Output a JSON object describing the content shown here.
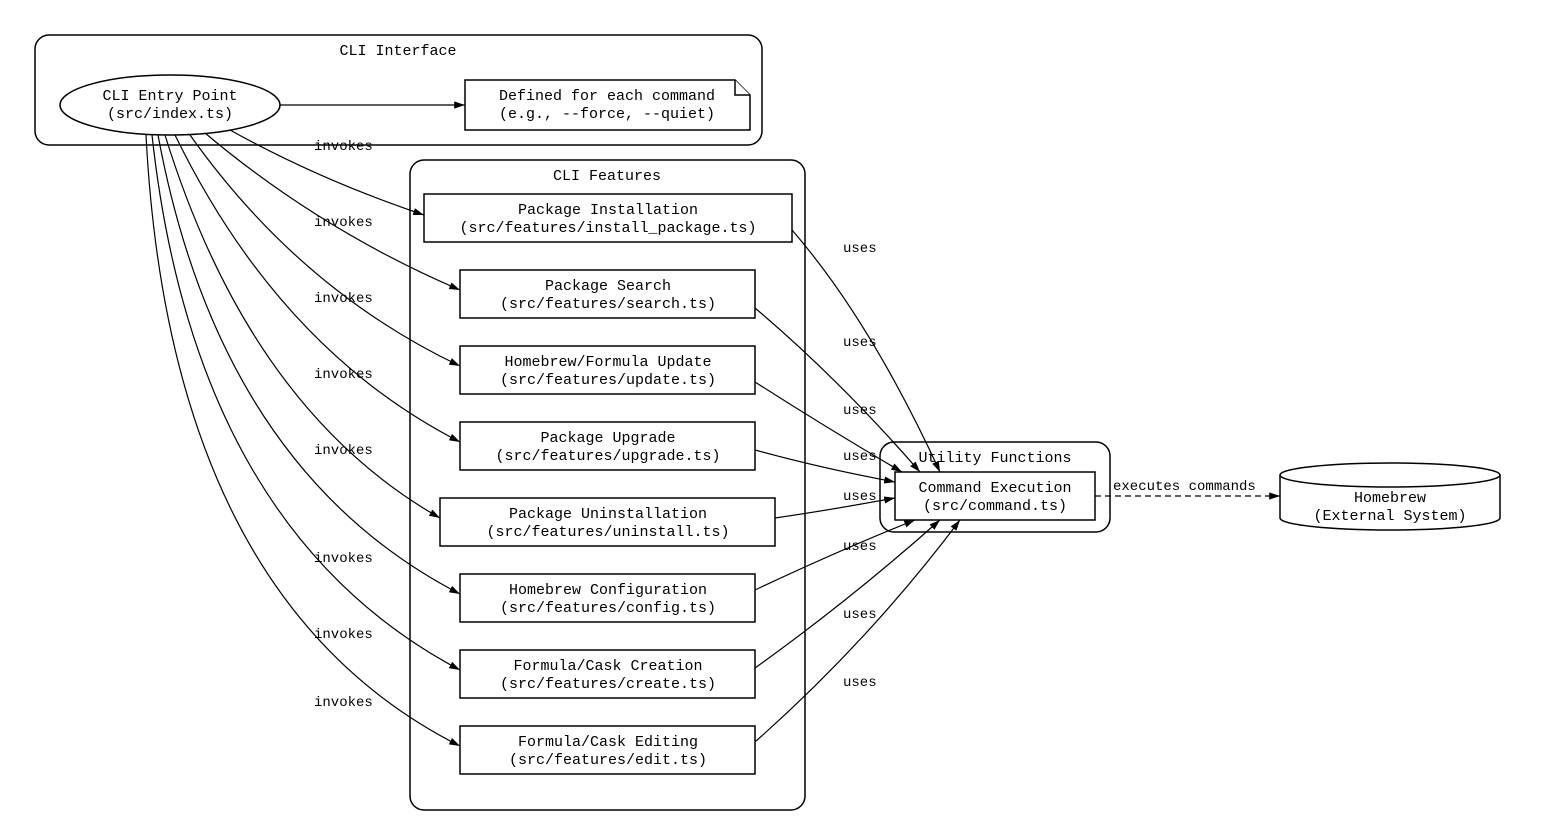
{
  "containers": {
    "cli_interface": {
      "title": "CLI Interface"
    },
    "cli_features": {
      "title": "CLI Features"
    },
    "utility": {
      "title": "Utility Functions"
    }
  },
  "nodes": {
    "entry": {
      "line1": "CLI Entry Point",
      "line2": "(src/index.ts)"
    },
    "note": {
      "line1": "Defined for each command",
      "line2": "(e.g., --force, --quiet)"
    },
    "install": {
      "line1": "Package Installation",
      "line2": "(src/features/install_package.ts)"
    },
    "search": {
      "line1": "Package Search",
      "line2": "(src/features/search.ts)"
    },
    "update": {
      "line1": "Homebrew/Formula Update",
      "line2": "(src/features/update.ts)"
    },
    "upgrade": {
      "line1": "Package Upgrade",
      "line2": "(src/features/upgrade.ts)"
    },
    "uninstall": {
      "line1": "Package Uninstallation",
      "line2": "(src/features/uninstall.ts)"
    },
    "config": {
      "line1": "Homebrew Configuration",
      "line2": "(src/features/config.ts)"
    },
    "create": {
      "line1": "Formula/Cask Creation",
      "line2": "(src/features/create.ts)"
    },
    "edit": {
      "line1": "Formula/Cask Editing",
      "line2": "(src/features/edit.ts)"
    },
    "command": {
      "line1": "Command Execution",
      "line2": "(src/command.ts)"
    },
    "homebrew": {
      "line1": "Homebrew",
      "line2": "(External System)"
    }
  },
  "edge_labels": {
    "invokes": "invokes",
    "uses": "uses",
    "executes": "executes commands"
  }
}
